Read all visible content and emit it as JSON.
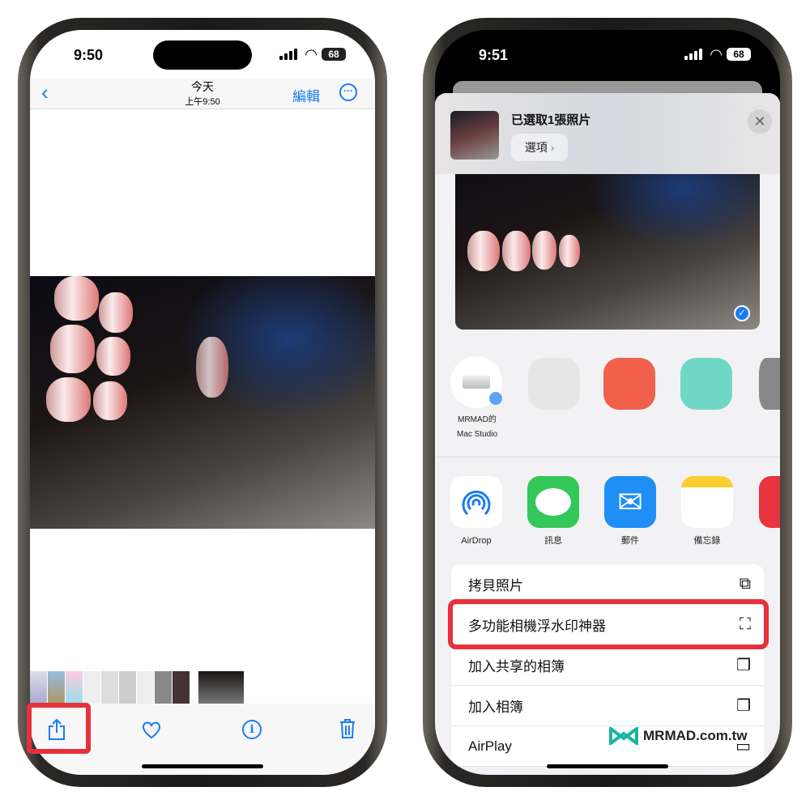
{
  "left": {
    "status": {
      "time": "9:50",
      "battery": "68"
    },
    "nav": {
      "title": "今天",
      "subtitle": "上午9:50",
      "edit": "編輯",
      "back_icon": "chevron-left-icon",
      "more_icon": "ellipsis-circle-icon"
    },
    "toolbar": {
      "share_icon": "share-icon",
      "favorite_icon": "heart-icon",
      "info_icon": "info-icon",
      "delete_icon": "trash-icon"
    }
  },
  "right": {
    "status": {
      "time": "9:51",
      "battery": "68"
    },
    "sheet": {
      "title": "已選取1張照片",
      "options": "選項",
      "close_icon": "close-icon"
    },
    "contacts": [
      {
        "name": "MRMAD的 Mac Studio"
      }
    ],
    "apps": [
      {
        "label": "AirDrop",
        "color": "#ffffff"
      },
      {
        "label": "訊息",
        "color": "#34c759"
      },
      {
        "label": "郵件",
        "color": "#1f8ff5"
      },
      {
        "label": "備忘錄",
        "color": "#ffffff"
      }
    ],
    "actions": [
      {
        "label": "拷貝照片",
        "icon": "copy-icon"
      },
      {
        "label": "多功能相機浮水印神器",
        "icon": "camera-viewfinder-icon"
      },
      {
        "label": "加入共享的相簿",
        "icon": "shared-album-icon"
      },
      {
        "label": "加入相簿",
        "icon": "add-album-icon"
      },
      {
        "label": "AirPlay",
        "icon": "airplay-icon"
      }
    ]
  },
  "watermark": "MRMAD.com.tw",
  "colors": {
    "accent": "#1a7cf2",
    "highlight": "#e6313c"
  }
}
